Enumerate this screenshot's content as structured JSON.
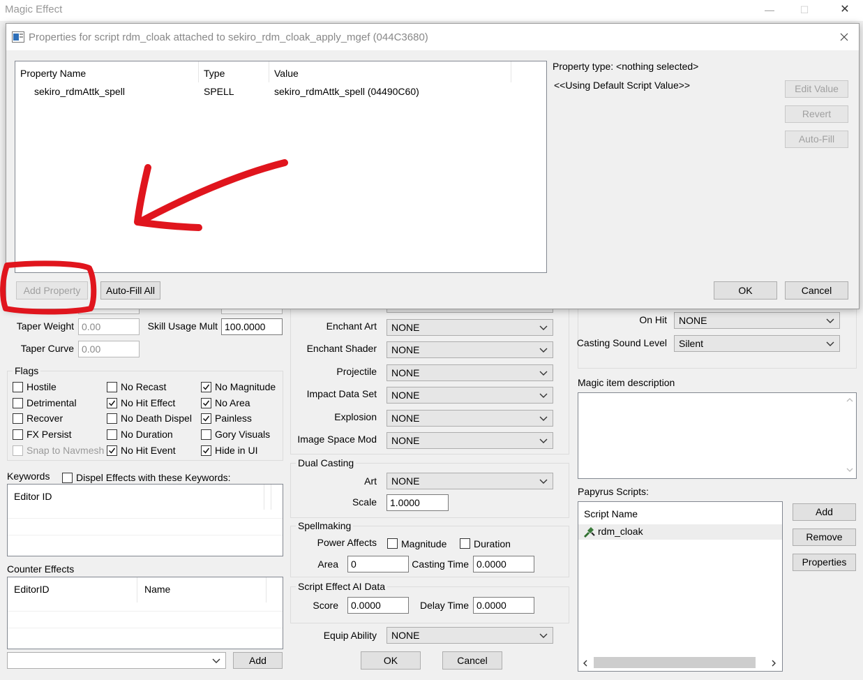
{
  "window": {
    "title": "Magic Effect",
    "controls": [
      "—",
      "☐",
      "✕"
    ]
  },
  "left": {
    "taper_weight_label": "Taper Weight",
    "taper_weight": "0.00",
    "skill_usage_mult_label": "Skill Usage Mult",
    "skill_usage_mult": "100.0000",
    "taper_curve_label": "Taper Curve",
    "taper_curve": "0.00",
    "flags_title": "Flags",
    "flags": [
      {
        "label": "Hostile",
        "checked": false
      },
      {
        "label": "Detrimental",
        "checked": false
      },
      {
        "label": "Recover",
        "checked": false
      },
      {
        "label": "FX Persist",
        "checked": false
      },
      {
        "label": "Snap to Navmesh",
        "checked": false,
        "disabled": true
      },
      {
        "label": "No Recast",
        "checked": false
      },
      {
        "label": "No Hit Effect",
        "checked": true
      },
      {
        "label": "No Death Dispel",
        "checked": false
      },
      {
        "label": "No Duration",
        "checked": false
      },
      {
        "label": "No Hit Event",
        "checked": true
      },
      {
        "label": "No Magnitude",
        "checked": true
      },
      {
        "label": "No Area",
        "checked": true
      },
      {
        "label": "Painless",
        "checked": true
      },
      {
        "label": "Gory Visuals",
        "checked": false
      },
      {
        "label": "Hide in UI",
        "checked": true
      }
    ],
    "keywords_label": "Keywords",
    "dispel_label": "Dispel Effects with these Keywords:",
    "editor_id_header": "Editor ID",
    "counter_effects_label": "Counter Effects",
    "counter_headers": [
      "EditorID",
      "Name"
    ],
    "add_button": "Add"
  },
  "middle": {
    "enchant_art_label": "Enchant Art",
    "enchant_shader_label": "Enchant Shader",
    "projectile_label": "Projectile",
    "impact_data_set_label": "Impact Data Set",
    "explosion_label": "Explosion",
    "image_space_mod_label": "Image Space Mod",
    "none_value": "NONE",
    "dual_casting_title": "Dual Casting",
    "art_label": "Art",
    "scale_label": "Scale",
    "scale_value": "1.0000",
    "spellmaking_title": "Spellmaking",
    "power_affects_label": "Power Affects",
    "magnitude_label": "Magnitude",
    "duration_label": "Duration",
    "area_label": "Area",
    "area_value": "0",
    "casting_time_label": "Casting Time",
    "casting_time_value": "0.0000",
    "script_ai_title": "Script Effect AI Data",
    "score_label": "Score",
    "score_value": "0.0000",
    "delay_time_label": "Delay Time",
    "delay_time_value": "0.0000",
    "equip_ability_label": "Equip Ability",
    "ok_button": "OK",
    "cancel_button": "Cancel"
  },
  "right": {
    "on_hit_label": "On Hit",
    "on_hit_value": "NONE",
    "casting_sound_label": "Casting Sound Level",
    "casting_sound_value": "Silent",
    "magic_desc_label": "Magic item description",
    "papyrus_label": "Papyrus Scripts:",
    "script_name_header": "Script Name",
    "script_item": "rdm_cloak",
    "add_button": "Add",
    "remove_button": "Remove",
    "properties_button": "Properties"
  },
  "dialog": {
    "title": "Properties for script rdm_cloak attached to sekiro_rdm_cloak_apply_mgef (044C3680)",
    "columns": [
      "Property Name",
      "Type",
      "Value"
    ],
    "rows": [
      {
        "name": "sekiro_rdmAttk_spell",
        "type": "SPELL",
        "value": "sekiro_rdmAttk_spell (04490C60)"
      }
    ],
    "property_type": "Property type: <nothing selected>",
    "default_value": "<<Using Default Script Value>>",
    "edit_value_button": "Edit Value",
    "revert_button": "Revert",
    "auto_fill_button": "Auto-Fill",
    "add_property_button": "Add Property",
    "auto_fill_all_button": "Auto-Fill All",
    "ok_button": "OK",
    "cancel_button": "Cancel"
  },
  "annotation_color": "#e0151d"
}
